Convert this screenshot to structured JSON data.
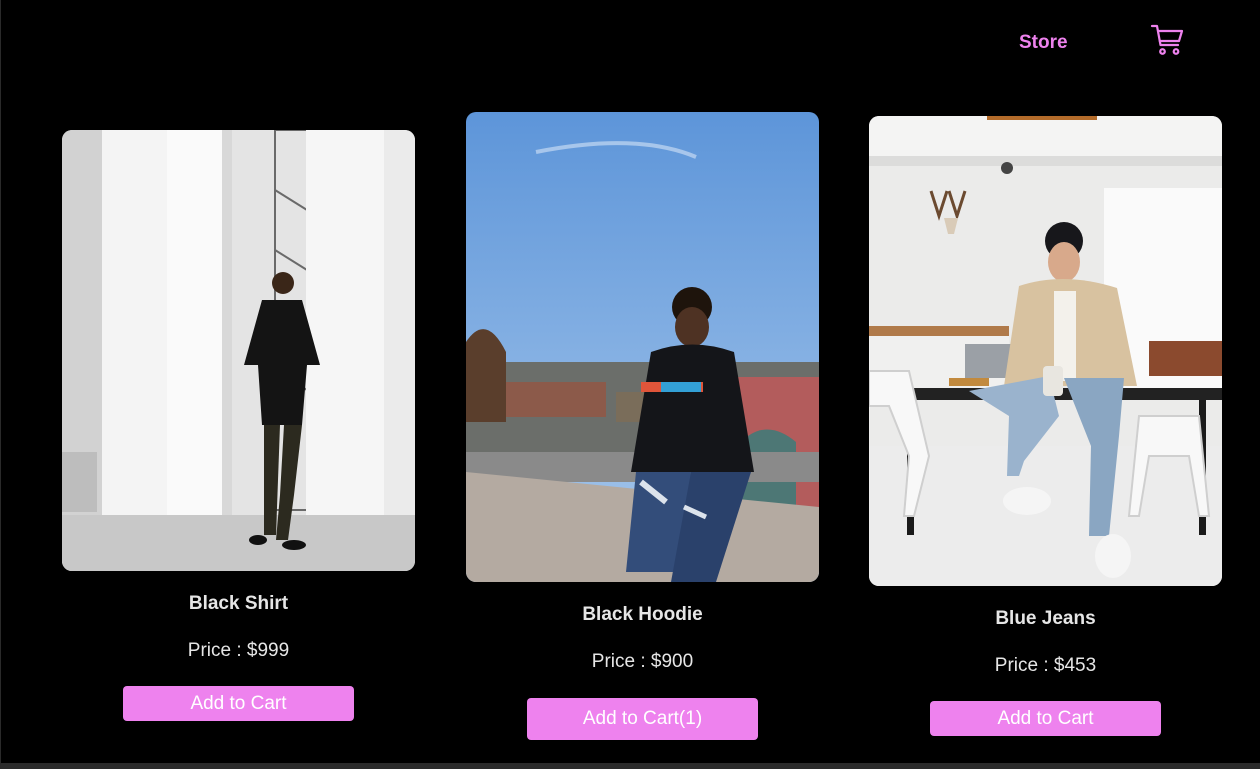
{
  "nav": {
    "store_label": "Store",
    "cart_icon": "shopping-cart-icon",
    "accent_color": "#ee82ee"
  },
  "products": [
    {
      "title": "Black Shirt",
      "price": "Price : $999",
      "button_label": "Add to Cart"
    },
    {
      "title": "Black Hoodie",
      "price": "Price : $900",
      "button_label": "Add to Cart(1)"
    },
    {
      "title": "Blue Jeans",
      "price": "Price : $453",
      "button_label": "Add to Cart"
    }
  ]
}
